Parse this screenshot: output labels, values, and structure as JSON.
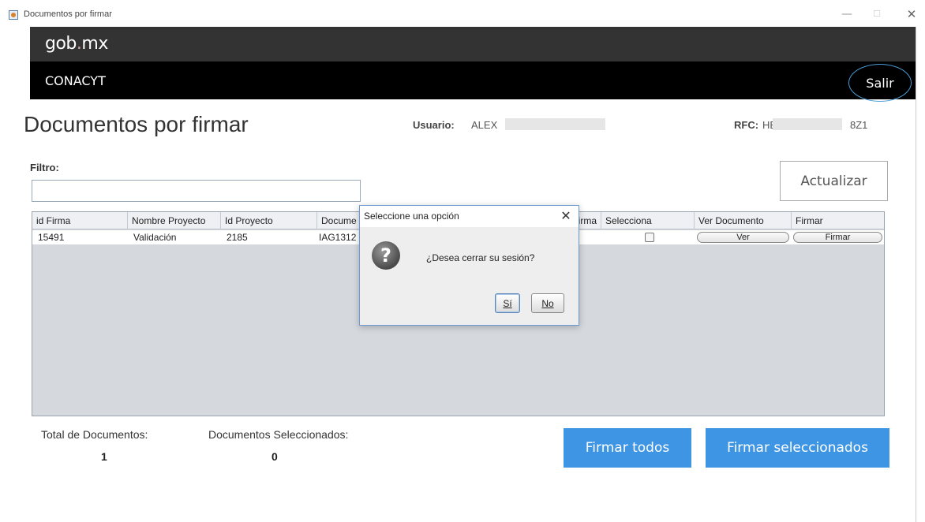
{
  "window": {
    "title": "Documentos por firmar",
    "min": "—",
    "max": "☐",
    "close": "✕"
  },
  "header": {
    "logo_main": "gob",
    "logo_dot": ".",
    "logo_suffix": "mx",
    "organization": "CONACYT",
    "logout": "Salir"
  },
  "page": {
    "title": "Documentos por firmar",
    "user_label": "Usuario:",
    "user_value": "ALEX",
    "rfc_label": "RFC:",
    "rfc_value": "HE",
    "rfc_suffix": "8Z1"
  },
  "filter": {
    "label": "Filtro:",
    "value": "",
    "refresh_button": "Actualizar"
  },
  "table": {
    "columns": [
      "id Firma",
      "Nombre Proyecto",
      "Id Proyecto",
      "Docume",
      "Firma",
      "Selecciona",
      "Ver Documento",
      "Firmar"
    ],
    "rows": [
      {
        "id_firma": "15491",
        "nombre_proyecto": "Validación",
        "id_proyecto": "2185",
        "documento": "IAG1312",
        "ver_label": "Ver",
        "firmar_label": "Firmar"
      }
    ]
  },
  "footer": {
    "total_label": "Total de Documentos:",
    "total_value": "1",
    "selected_label": "Documentos Seleccionados:",
    "selected_value": "0",
    "sign_all_button": "Firmar todos",
    "sign_selected_button": "Firmar seleccionados"
  },
  "dialog": {
    "title": "Seleccione una opción",
    "close": "✕",
    "icon": "question-icon",
    "icon_glyph": "?",
    "message": "¿Desea cerrar su sesión?",
    "yes_button": "Sí",
    "no_button": "No"
  },
  "colors": {
    "accent_blue": "#3d95e3",
    "header_dark": "#333333",
    "header_black": "#000000",
    "logout_ring": "#4a9ed8"
  }
}
